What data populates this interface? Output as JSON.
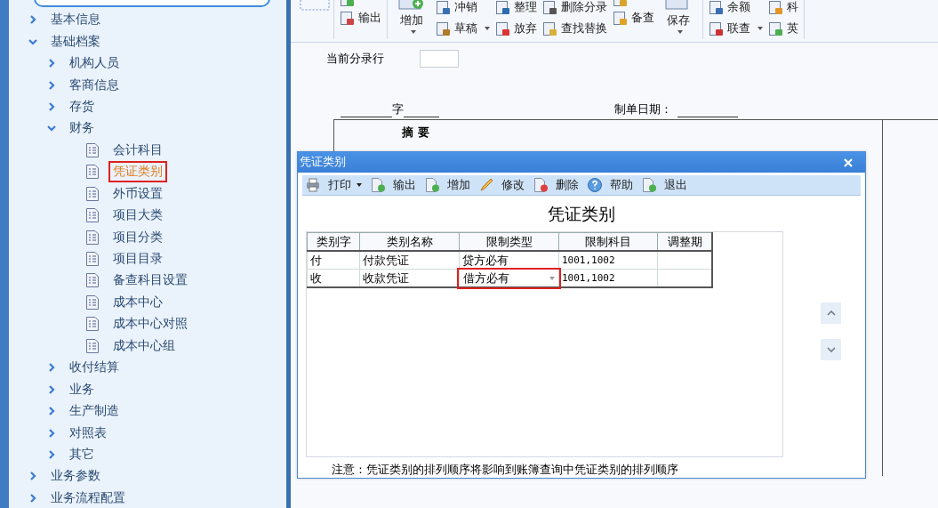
{
  "sidebar": {
    "tree": [
      {
        "label": "基本信息",
        "expanded": false,
        "selected": false
      },
      {
        "label": "基础档案",
        "expanded": true,
        "selected": false,
        "children": [
          {
            "label": "机构人员",
            "expanded": false,
            "selected": false
          },
          {
            "label": "客商信息",
            "expanded": false,
            "selected": false
          },
          {
            "label": "存货",
            "expanded": false,
            "selected": false
          },
          {
            "label": "财务",
            "expanded": true,
            "selected": false,
            "children": [
              {
                "label": "会计科目",
                "selected": false
              },
              {
                "label": "凭证类别",
                "selected": true
              },
              {
                "label": "外币设置",
                "selected": false
              },
              {
                "label": "项目大类",
                "selected": false
              },
              {
                "label": "项目分类",
                "selected": false
              },
              {
                "label": "项目目录",
                "selected": false
              },
              {
                "label": "备查科目设置",
                "selected": false
              },
              {
                "label": "成本中心",
                "selected": false
              },
              {
                "label": "成本中心对照",
                "selected": false
              },
              {
                "label": "成本中心组",
                "selected": false
              }
            ]
          },
          {
            "label": "收付结算",
            "expanded": false,
            "selected": false
          },
          {
            "label": "业务",
            "expanded": false,
            "selected": false
          },
          {
            "label": "生产制造",
            "expanded": false,
            "selected": false
          },
          {
            "label": "对照表",
            "expanded": false,
            "selected": false
          },
          {
            "label": "其它",
            "expanded": false,
            "selected": false
          }
        ]
      },
      {
        "label": "业务参数",
        "expanded": false,
        "selected": false
      },
      {
        "label": "业务流程配置",
        "expanded": false,
        "selected": false
      }
    ]
  },
  "toolbar": {
    "groups": [
      {
        "columns": [
          {
            "kind": "stack",
            "items": [
              {
                "dropdown": false
              },
              {
                "label": "输出",
                "dropdown": false
              }
            ]
          }
        ]
      },
      {
        "columns": [
          {
            "kind": "large",
            "label": "增加",
            "dropdown": true
          },
          {
            "kind": "stack",
            "items": [
              {
                "label": "冲销",
                "dropdown": false
              },
              {
                "label": "草稿",
                "dropdown": true
              }
            ]
          },
          {
            "kind": "stack",
            "items": [
              {
                "label": "整理",
                "dropdown": false
              },
              {
                "label": "放弃",
                "dropdown": false
              }
            ]
          },
          {
            "kind": "stack",
            "items": [
              {
                "label": "删除分录",
                "dropdown": false
              },
              {
                "label": "查找替换",
                "dropdown": false
              }
            ]
          },
          {
            "kind": "stack",
            "items": [
              {
                "dropdown": false
              },
              {
                "label": "备查",
                "dropdown": false
              }
            ]
          },
          {
            "kind": "large",
            "label": "保存",
            "dropdown": true
          }
        ]
      },
      {
        "columns": [
          {
            "kind": "stack",
            "items": [
              {
                "label": "余额",
                "dropdown": false
              },
              {
                "label": "联查",
                "dropdown": true
              }
            ]
          },
          {
            "kind": "stack",
            "items": [
              {
                "label": "科",
                "dropdown": false
              },
              {
                "label": "英",
                "dropdown": false
              }
            ]
          }
        ]
      }
    ]
  },
  "entry_row": {
    "label": "当前分录行"
  },
  "voucher": {
    "type_suffix": "字",
    "date_label": "制单日期：",
    "summary_header": "摘 要"
  },
  "dialog": {
    "title": "凭证类别",
    "toolbar": [
      {
        "label": "打印",
        "dropdown": true
      },
      {
        "label": "输出",
        "dropdown": false
      },
      {
        "label": "增加",
        "dropdown": false
      },
      {
        "label": "修改",
        "dropdown": false
      },
      {
        "label": "删除",
        "dropdown": false
      },
      {
        "label": "帮助",
        "dropdown": false
      },
      {
        "label": "退出",
        "dropdown": false
      }
    ],
    "heading": "凭证类别",
    "table": {
      "columns": [
        "类别字",
        "类别名称",
        "限制类型",
        "限制科目",
        "调整期"
      ],
      "rows": [
        {
          "code": "付",
          "name": "付款凭证",
          "restriction": {
            "text": "贷方必有",
            "editing": false
          },
          "subjects": "1001,1002"
        },
        {
          "code": "收",
          "name": "收款凭证",
          "restriction": {
            "text": "借方必有",
            "editing": true
          },
          "subjects": "1001,1002"
        }
      ]
    },
    "note": "注意：凭证类别的排列顺序将影响到账簿查询中凭证类别的排列顺序"
  }
}
